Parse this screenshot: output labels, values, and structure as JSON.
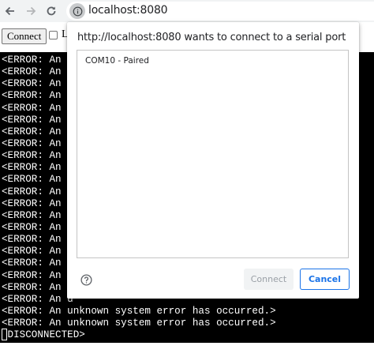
{
  "browser": {
    "url": "localhost:8080"
  },
  "page": {
    "connect_label": "Connect",
    "checkbox_label": "L"
  },
  "terminal": {
    "lines": [
      "<ERROR: An u",
      "<ERROR: An u",
      "<ERROR: An u",
      "<ERROR: An u",
      "<ERROR: An u",
      "<ERROR: An u",
      "<ERROR: An u",
      "<ERROR: An u",
      "<ERROR: An u",
      "<ERROR: An u",
      "<ERROR: An u",
      "<ERROR: An u",
      "<ERROR: An u",
      "<ERROR: An u",
      "<ERROR: An u",
      "<ERROR: An u",
      "<ERROR: An u",
      "<ERROR: An u",
      "<ERROR: An u",
      "<ERROR: An u",
      "<ERROR: An u",
      "<ERROR: An unknown system error has occurred.>",
      "<ERROR: An unknown system error has occurred.>",
      "<DISCONNECTED>"
    ]
  },
  "dialog": {
    "title": "http://localhost:8080 wants to connect to a serial port",
    "ports": [
      "COM10 - Paired"
    ],
    "connect_label": "Connect",
    "cancel_label": "Cancel",
    "colors": {
      "accent": "#1a73e8",
      "disabled_text": "#9aa0a6"
    }
  }
}
